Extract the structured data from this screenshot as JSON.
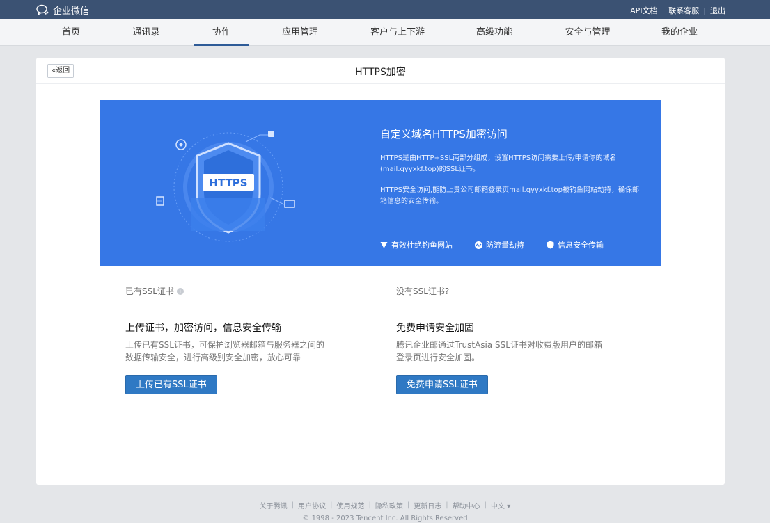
{
  "topbar": {
    "logo_text": "企业微信",
    "links": [
      "API文档",
      "联系客服",
      "退出"
    ]
  },
  "nav": {
    "items": [
      "首页",
      "通讯录",
      "协作",
      "应用管理",
      "客户与上下游",
      "高级功能",
      "安全与管理",
      "我的企业"
    ],
    "active": "协作"
  },
  "card": {
    "back_label": "«返回",
    "title": "HTTPS加密"
  },
  "banner": {
    "badge_text": "HTTPS",
    "title": "自定义域名HTTPS加密访问",
    "para1": "HTTPS是由HTTP+SSL两部分组成，设置HTTPS访问需要上传/申请你的域名(mail.qyyxkf.top)的SSL证书。",
    "para2": "HTTPS安全访问,能防止贵公司邮箱登录页mail.qyyxkf.top被钓鱼网站劫持，确保邮箱信息的安全传输。",
    "features": [
      "有效杜绝钓鱼网站",
      "防流量劫持",
      "信息安全传输"
    ]
  },
  "left": {
    "label": "已有SSL证书",
    "heading": "上传证书，加密访问，信息安全传输",
    "desc_line1": "上传已有SSL证书，可保护浏览器邮箱与服务器之间的",
    "desc_line2": "数据传输安全，进行高级别安全加密，放心可靠",
    "button": "上传已有SSL证书"
  },
  "right": {
    "label": "没有SSL证书?",
    "heading": "免费申请安全加固",
    "desc_line1": "腾讯企业邮通过TrustAsia SSL证书对收费版用户的邮箱",
    "desc_line2": "登录页进行安全加固。",
    "button": "免费申请SSL证书"
  },
  "footer": {
    "links": [
      "关于腾讯",
      "用户协议",
      "使用规范",
      "隐私政策",
      "更新日志",
      "帮助中心",
      "中文 ▾"
    ],
    "copyright": "© 1998 - 2023 Tencent Inc. All Rights Reserved"
  },
  "colors": {
    "topbar": "#3b5273",
    "banner": "#3677e6",
    "primary_button": "#2f79c4"
  }
}
